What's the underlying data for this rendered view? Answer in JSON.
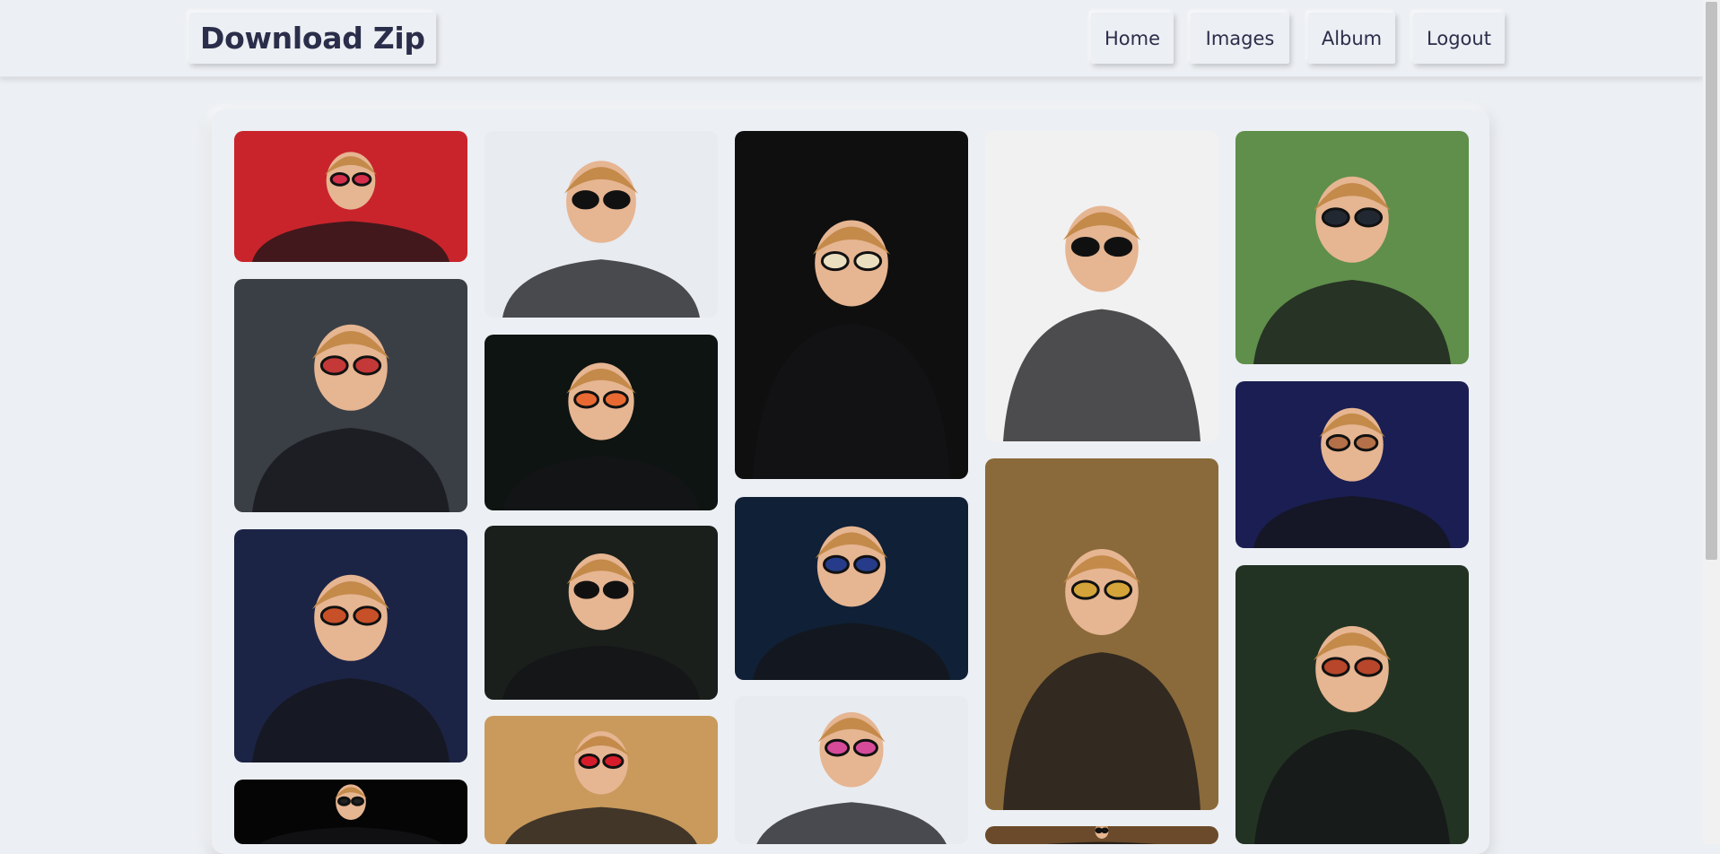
{
  "navbar": {
    "brand": "Download Zip",
    "links": [
      {
        "label": "Home"
      },
      {
        "label": "Images"
      },
      {
        "label": "Album"
      },
      {
        "label": "Logout"
      }
    ]
  },
  "gallery": {
    "photos": [
      {
        "column": 1,
        "bg": "#c9242b",
        "accent": "#d62d4a",
        "subject": "man-red-glasses-stage"
      },
      {
        "column": 1,
        "bg": "#3a3f45",
        "accent": "#c43838",
        "subject": "man-black-jacket-crowd"
      },
      {
        "column": 1,
        "bg": "#1c2446",
        "accent": "#c85028",
        "subject": "man-piano-blue-suit"
      },
      {
        "column": 1,
        "bg": "#050505",
        "accent": "#222222",
        "subject": "dark-photo"
      },
      {
        "column": 2,
        "bg": "#e8ebf0",
        "accent": "#111111",
        "subject": "man-black-glasses-event"
      },
      {
        "column": 2,
        "bg": "#0e1411",
        "accent": "#e86a32",
        "subject": "man-orange-glasses-smiling"
      },
      {
        "column": 2,
        "bg": "#1a1f1b",
        "accent": "#101010",
        "subject": "man-sunglasses-hands"
      },
      {
        "column": 2,
        "bg": "#c99a5c",
        "accent": "#d61c2a",
        "subject": "woman-red-dress"
      },
      {
        "column": 3,
        "bg": "#0f0f0f",
        "accent": "#eae0c0",
        "subject": "man-straw-hat-piano"
      },
      {
        "column": 3,
        "bg": "#102036",
        "accent": "#263c8a",
        "subject": "man-piano-concert"
      },
      {
        "column": 3,
        "bg": "#e8ecf1",
        "accent": "#d64a9a",
        "subject": "man-pink-glasses"
      },
      {
        "column": 4,
        "bg": "#f1f1f1",
        "accent": "#101010",
        "subject": "man-black-glasses-tuxedo"
      },
      {
        "column": 4,
        "bg": "#8a6a3a",
        "accent": "#d4a43a",
        "subject": "couple-vintage"
      },
      {
        "column": 4,
        "bg": "#6a4a2a",
        "accent": "#3a2a1a",
        "subject": "partial-photo"
      },
      {
        "column": 5,
        "bg": "#5f8f4a",
        "accent": "#222831",
        "subject": "couple-walking-street"
      },
      {
        "column": 5,
        "bg": "#1a1e52",
        "accent": "#b47048",
        "subject": "man-microphone-glasses"
      },
      {
        "column": 5,
        "bg": "#233323",
        "accent": "#b8462a",
        "subject": "man-vintage-sunglasses"
      }
    ]
  }
}
